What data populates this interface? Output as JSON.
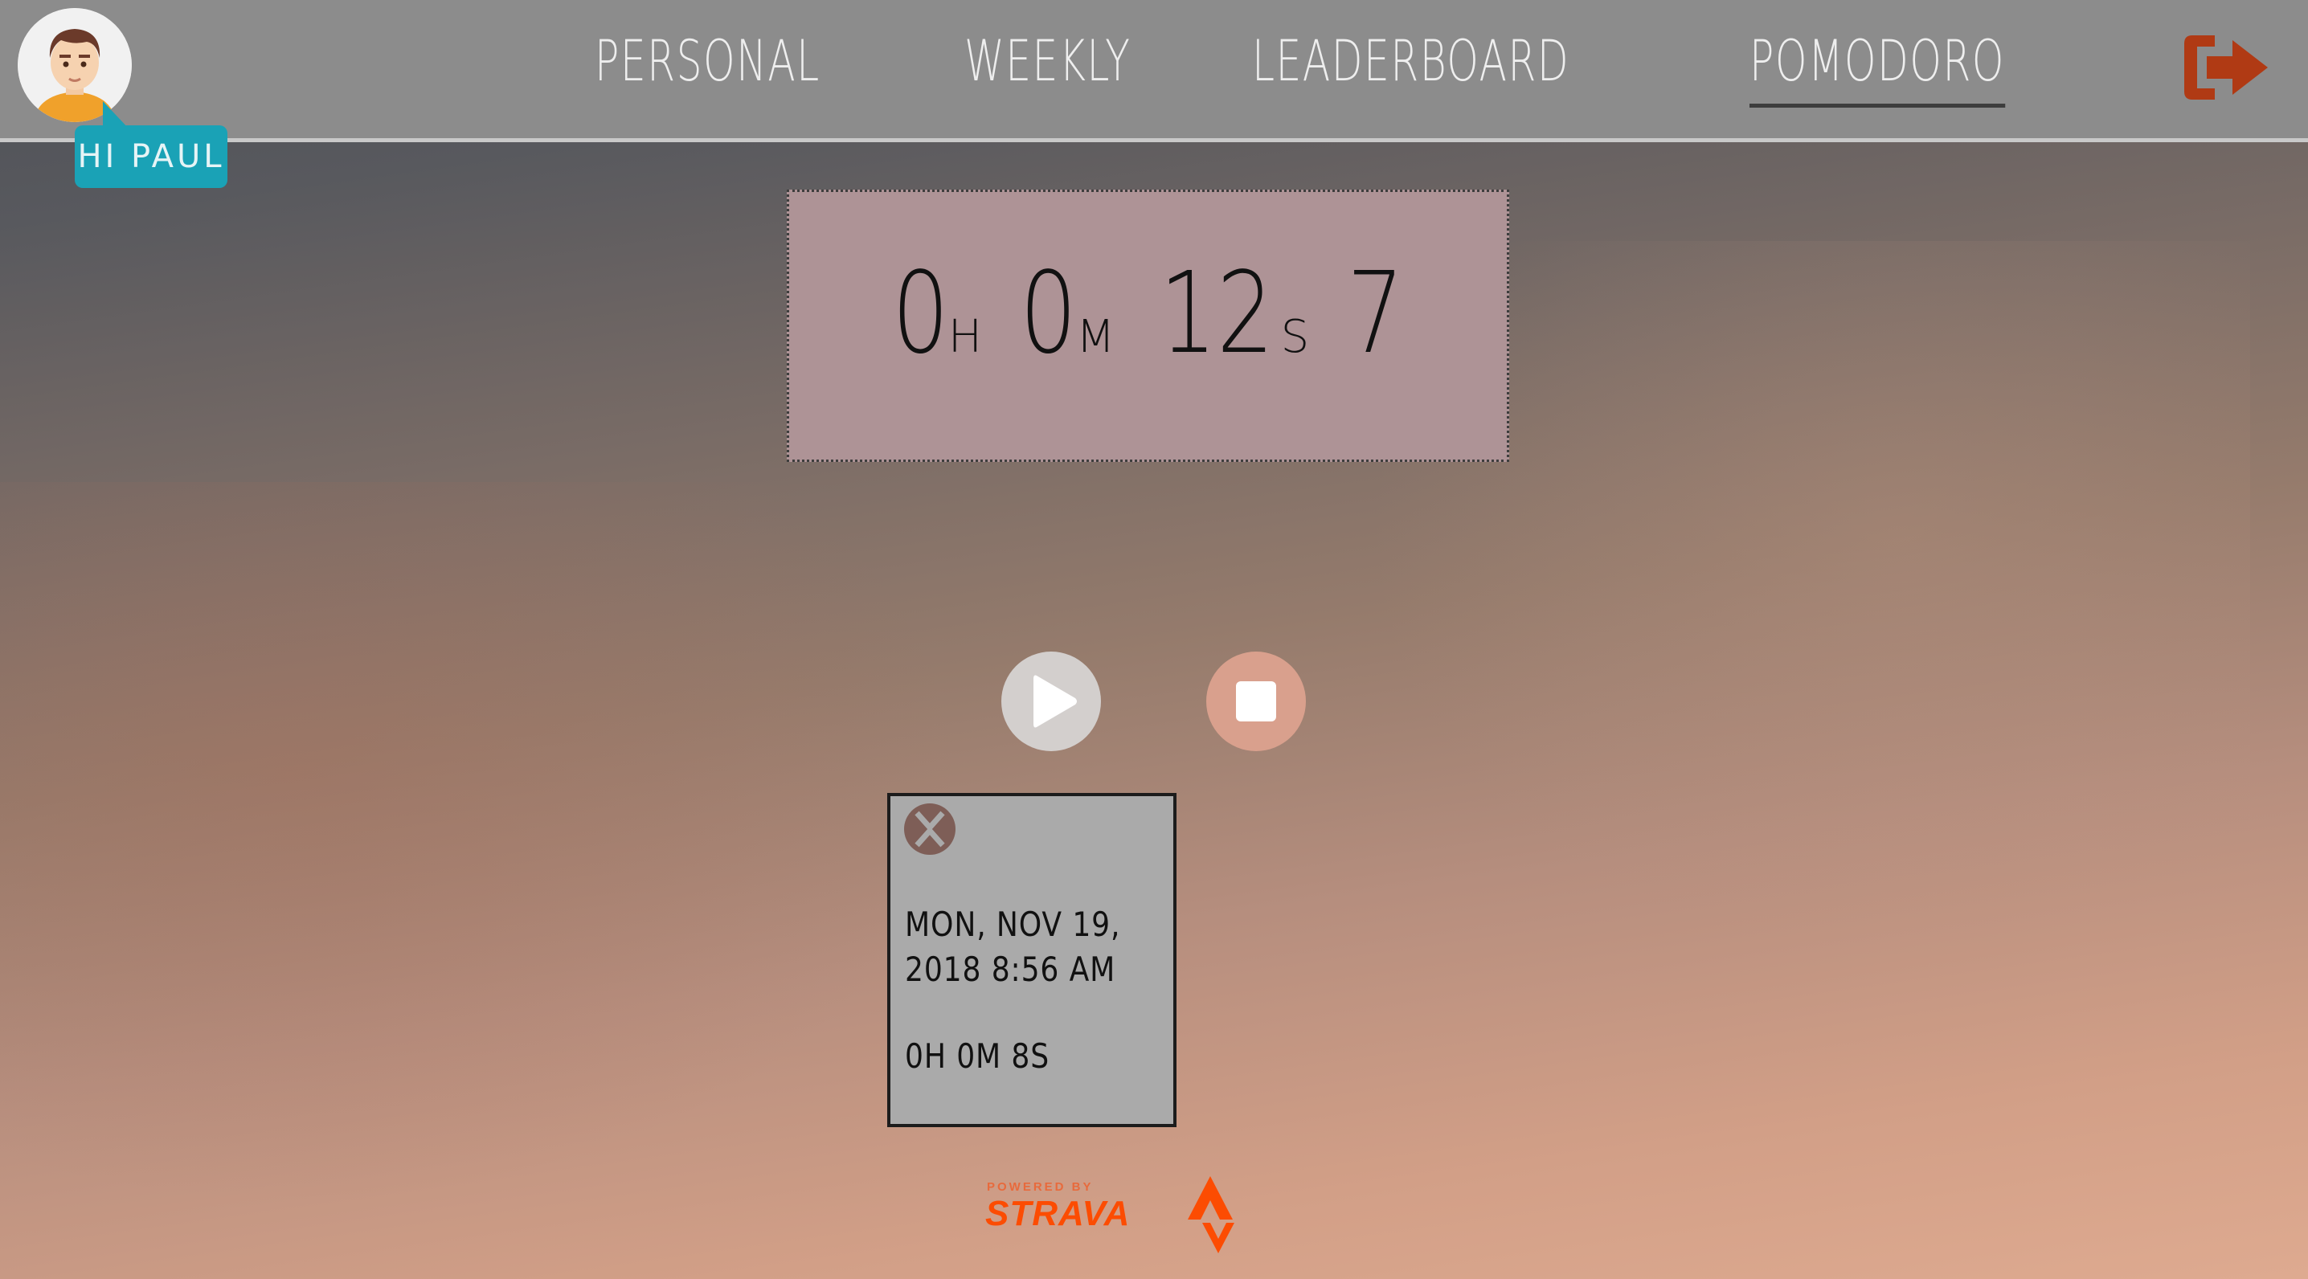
{
  "user": {
    "greeting": "HI PAUL",
    "avatar_icon": "user-avatar-icon"
  },
  "nav": {
    "items": [
      {
        "label": "PERSONAL"
      },
      {
        "label": "WEEKLY"
      },
      {
        "label": "LEADERBOARD"
      },
      {
        "label": "POMODORO"
      }
    ],
    "active": "POMODORO"
  },
  "timer": {
    "hours": "0",
    "hours_unit": "H",
    "minutes": "0",
    "minutes_unit": "M",
    "seconds": "12",
    "seconds_unit": "S",
    "extra": "7"
  },
  "controls": {
    "play_icon": "play-icon",
    "stop_icon": "stop-icon"
  },
  "session_card": {
    "date": "MON, NOV 19, 2018 8:56 AM",
    "duration": "0H 0M 8S",
    "delete_icon": "close-circle-icon"
  },
  "footer": {
    "powered_by": "POWERED BY",
    "brand": "STRAVA"
  },
  "colors": {
    "topbar": "#8c8c8c",
    "greeting_bg": "#1aa2b6",
    "logout": "#b03a14",
    "timer_bg": "#ae9396",
    "stop_button": "#d9a08d",
    "strava_orange": "#fc4c02"
  }
}
